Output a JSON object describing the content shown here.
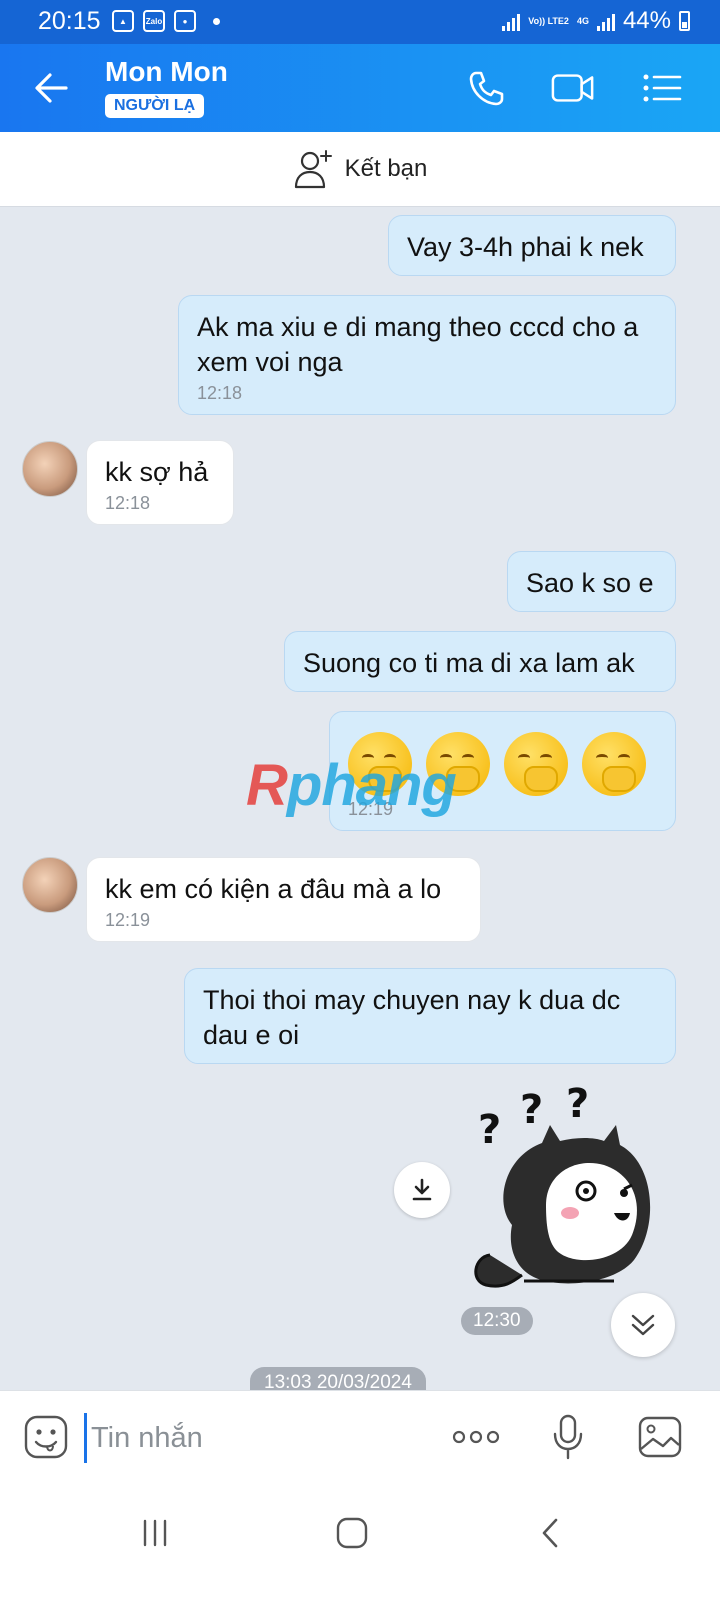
{
  "status_bar": {
    "time": "20:15",
    "network": "4G",
    "volte": "Vo)) LTE2",
    "battery": "44%",
    "battery_level": 0.44
  },
  "header": {
    "contact_name": "Mon Mon",
    "tag": "NGƯỜI LẠ",
    "icons": [
      "back-arrow-icon",
      "phone-icon",
      "video-icon",
      "menu-list-icon"
    ]
  },
  "add_friend": {
    "label": "Kết bạn"
  },
  "messages": [
    {
      "dir": "out",
      "text": "Vay 3-4h phai k nek",
      "time": ""
    },
    {
      "dir": "out",
      "text": "Ak ma xiu e di mang theo cccd cho a xem voi nga",
      "time": "12:18"
    },
    {
      "dir": "in",
      "text": "kk sợ hả",
      "time": "12:18"
    },
    {
      "dir": "out",
      "text": "Sao k so e",
      "time": ""
    },
    {
      "dir": "out",
      "text": "Suong co ti ma di xa lam ak",
      "time": ""
    },
    {
      "dir": "out",
      "emoji": "face-with-hand-over-mouth x4",
      "time": "12:19"
    },
    {
      "dir": "in",
      "text": "kk em có kiện a đâu mà a lo",
      "time": "12:19"
    },
    {
      "dir": "out",
      "text": "Thoi thoi may chuyen nay k dua dc dau e oi",
      "time": ""
    }
  ],
  "sticker": {
    "name": "husky-question-sticker",
    "time": "12:30"
  },
  "date_separator": "13:03 20/03/2024",
  "watermark": "Rphang",
  "composer": {
    "placeholder": "Tin nhắn",
    "icons": [
      "sticker-icon",
      "more-icon",
      "mic-icon",
      "image-icon"
    ]
  },
  "colors": {
    "header_start": "#1976f0",
    "header_end": "#1aa6f5",
    "status_bar": "#1565d4",
    "outgoing_bubble": "#d6ecfb",
    "incoming_bubble": "#ffffff",
    "chat_bg": "#e3e8ef"
  }
}
